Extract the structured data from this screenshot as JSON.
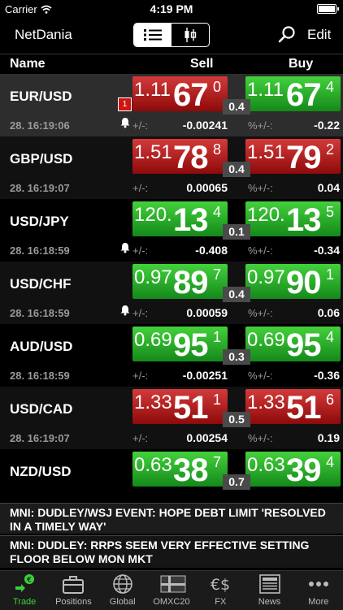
{
  "status_bar": {
    "carrier": "Carrier",
    "time": "4:19 PM"
  },
  "nav": {
    "brand": "NetDania",
    "edit": "Edit"
  },
  "columns": {
    "name": "Name",
    "sell": "Sell",
    "buy": "Buy"
  },
  "labels": {
    "chg": "+/-:",
    "pct": "%+/-:"
  },
  "colors": {
    "up": "#2fbf2f",
    "down": "#b01818",
    "active_tab": "#3ccf3c"
  },
  "rows": [
    {
      "symbol": "EUR/USD",
      "time": "28. 16:19:06",
      "alert_count": "1",
      "bell": true,
      "sell": {
        "small": "1.11",
        "big": "67",
        "sup": "0",
        "dir": "down"
      },
      "buy": {
        "small": "1.11",
        "big": "67",
        "sup": "4",
        "dir": "up"
      },
      "spread": "0.4",
      "change": "-0.00241",
      "pct": "-0.22"
    },
    {
      "symbol": "GBP/USD",
      "time": "28. 16:19:07",
      "bell": false,
      "sell": {
        "small": "1.51",
        "big": "78",
        "sup": "8",
        "dir": "down"
      },
      "buy": {
        "small": "1.51",
        "big": "79",
        "sup": "2",
        "dir": "down"
      },
      "spread": "0.4",
      "change": "0.00065",
      "pct": "0.04"
    },
    {
      "symbol": "USD/JPY",
      "time": "28. 16:18:59",
      "bell": true,
      "sell": {
        "small": "120.",
        "big": "13",
        "sup": "4",
        "dir": "up"
      },
      "buy": {
        "small": "120.",
        "big": "13",
        "sup": "5",
        "dir": "up"
      },
      "spread": "0.1",
      "change": "-0.408",
      "pct": "-0.34"
    },
    {
      "symbol": "USD/CHF",
      "time": "28. 16:18:59",
      "bell": true,
      "sell": {
        "small": "0.97",
        "big": "89",
        "sup": "7",
        "dir": "up"
      },
      "buy": {
        "small": "0.97",
        "big": "90",
        "sup": "1",
        "dir": "up"
      },
      "spread": "0.4",
      "change": "0.00059",
      "pct": "0.06"
    },
    {
      "symbol": "AUD/USD",
      "time": "28. 16:18:59",
      "bell": false,
      "sell": {
        "small": "0.69",
        "big": "95",
        "sup": "1",
        "dir": "up"
      },
      "buy": {
        "small": "0.69",
        "big": "95",
        "sup": "4",
        "dir": "up"
      },
      "spread": "0.3",
      "change": "-0.00251",
      "pct": "-0.36"
    },
    {
      "symbol": "USD/CAD",
      "time": "28. 16:19:07",
      "bell": false,
      "sell": {
        "small": "1.33",
        "big": "51",
        "sup": "1",
        "dir": "down"
      },
      "buy": {
        "small": "1.33",
        "big": "51",
        "sup": "6",
        "dir": "down"
      },
      "spread": "0.5",
      "change": "0.00254",
      "pct": "0.19"
    },
    {
      "symbol": "NZD/USD",
      "time": "",
      "bell": false,
      "sell": {
        "small": "0.63",
        "big": "38",
        "sup": "7",
        "dir": "up"
      },
      "buy": {
        "small": "0.63",
        "big": "39",
        "sup": "4",
        "dir": "up"
      },
      "spread": "0.7",
      "change": "",
      "pct": ""
    }
  ],
  "news": [
    "MNI: DUDLEY/WSJ EVENT: HOPE DEBT LIMIT 'RESOLVED IN A TIMELY WAY'",
    "MNI: DUDLEY: RRPS SEEM VERY EFFECTIVE SETTING FLOOR BELOW MON MKT"
  ],
  "tabs": [
    {
      "label": "Trade",
      "icon": "trade-icon",
      "active": true
    },
    {
      "label": "Positions",
      "icon": "briefcase-icon",
      "active": false
    },
    {
      "label": "Global",
      "icon": "globe-icon",
      "active": false
    },
    {
      "label": "OMXC20",
      "icon": "flag-icon",
      "active": false
    },
    {
      "label": "FX",
      "icon": "currency-icon",
      "active": false
    },
    {
      "label": "News",
      "icon": "news-icon",
      "active": false
    },
    {
      "label": "More",
      "icon": "more-icon",
      "active": false
    }
  ]
}
